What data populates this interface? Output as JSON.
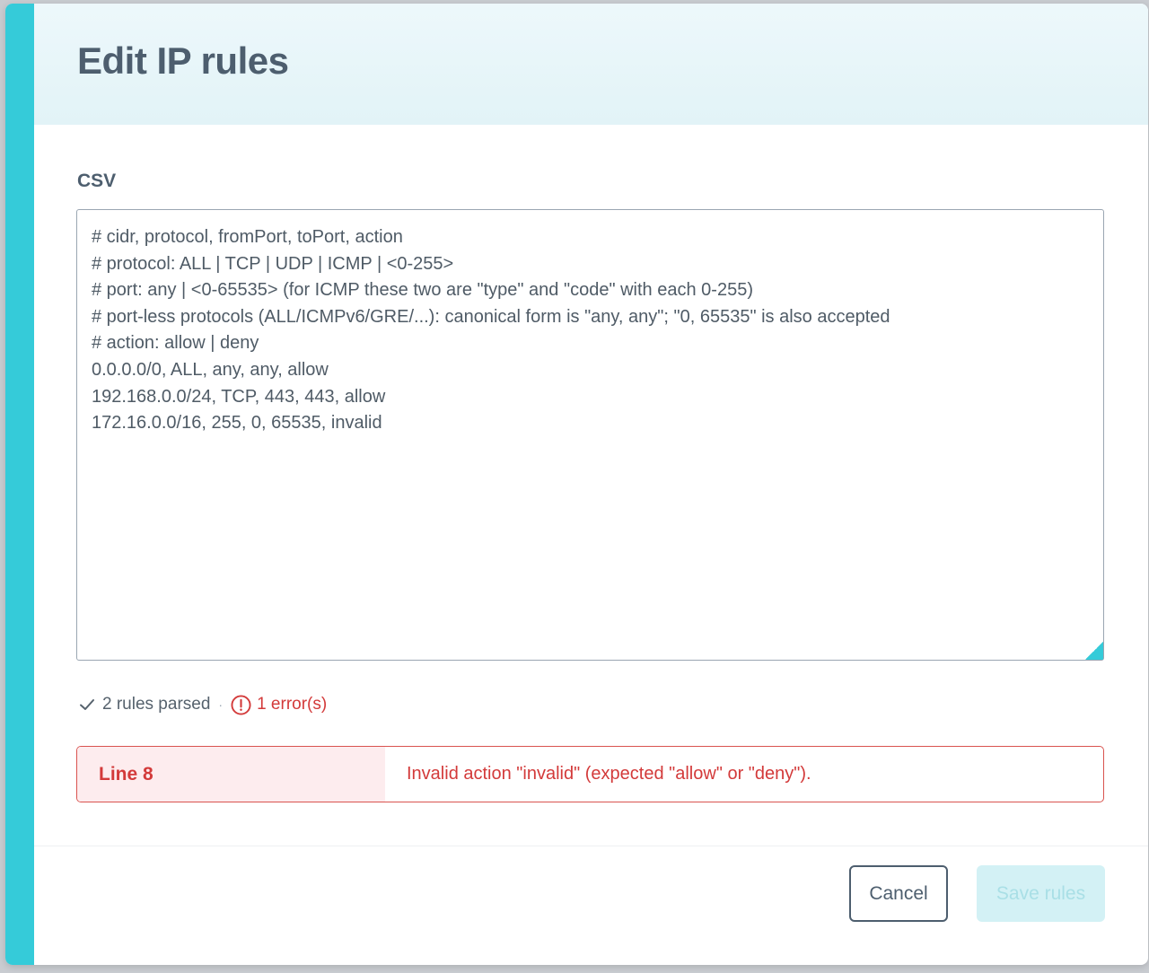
{
  "modal": {
    "title": "Edit IP rules",
    "accent_color": "#35cbd9"
  },
  "csv_field": {
    "label": "CSV",
    "lines": [
      "# cidr, protocol, fromPort, toPort, action",
      "# protocol: ALL | TCP | UDP | ICMP | <0-255>",
      "# port: any | <0-65535> (for ICMP these two are \"type\" and \"code\" with each 0-255)",
      "# port-less protocols (ALL/ICMPv6/GRE/...): canonical form is \"any, any\"; \"0, 65535\" is also accepted",
      "# action: allow | deny",
      "0.0.0.0/0, ALL, any, any, allow",
      "192.168.0.0/24, TCP, 443, 443, allow",
      "172.16.0.0/16, 255, 0, 65535, invalid"
    ]
  },
  "parse_status": {
    "rules_parsed": "2 rules parsed",
    "separator": "·",
    "errors": "1 error(s)",
    "error_color": "#d33a3a"
  },
  "errors": [
    {
      "line": "Line 8",
      "message": "Invalid action \"invalid\" (expected \"allow\" or \"deny\")."
    }
  ],
  "footer": {
    "cancel_label": "Cancel",
    "save_label": "Save rules"
  }
}
